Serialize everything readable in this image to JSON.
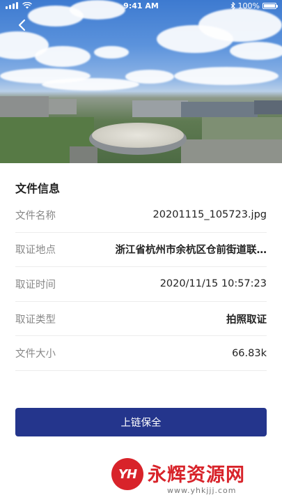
{
  "status_bar": {
    "time": "9:41 AM",
    "battery": "100%",
    "battery_level": 1.0,
    "icons": [
      "signal-icon",
      "wifi-icon",
      "bluetooth-icon",
      "battery-icon"
    ]
  },
  "header": {
    "back_icon": "chevron-left-icon"
  },
  "info": {
    "title": "文件信息",
    "rows": [
      {
        "label": "文件名称",
        "value": "20201115_105723.jpg"
      },
      {
        "label": "取证地点",
        "value": "浙江省杭州市余杭区仓前街道联…"
      },
      {
        "label": "取证时间",
        "value": "2020/11/15 10:57:23"
      },
      {
        "label": "取证类型",
        "value": "拍照取证"
      },
      {
        "label": "文件大小",
        "value": "66.83k"
      }
    ]
  },
  "actions": {
    "submit_label": "上链保全"
  },
  "watermark": {
    "logo_text": "YH",
    "title": "永辉资源网",
    "url": "www.yhkjjj.com"
  },
  "colors": {
    "primary": "#24358c",
    "watermark": "#d8232a",
    "label": "#888888",
    "text": "#222222"
  }
}
